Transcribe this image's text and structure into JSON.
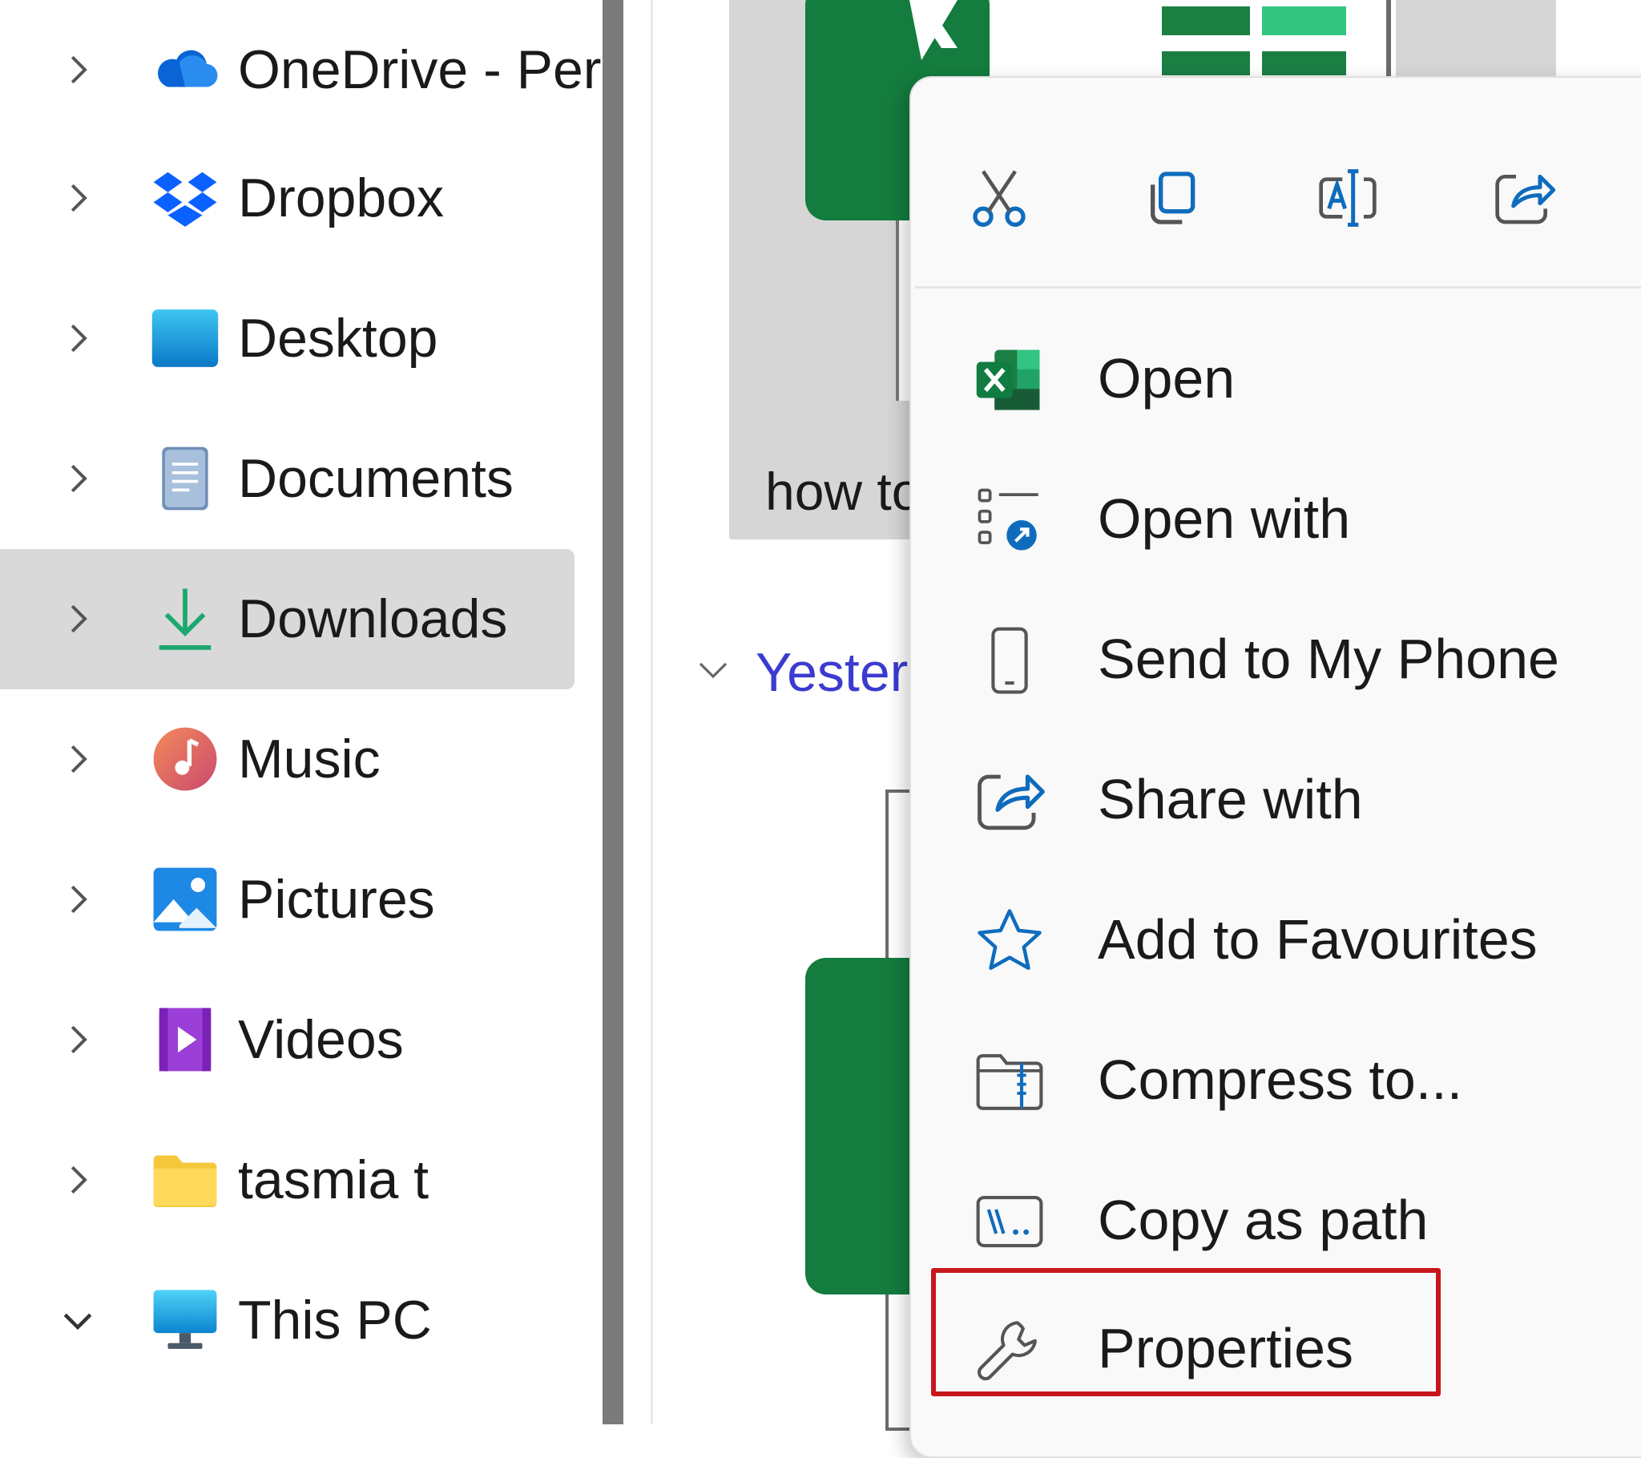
{
  "sidebar": {
    "items": [
      {
        "label": "OneDrive - Per",
        "icon": "onedrive-cloud-icon",
        "expanded": false,
        "selected": false
      },
      {
        "label": "Dropbox",
        "icon": "dropbox-icon",
        "expanded": false,
        "selected": false
      },
      {
        "label": "Desktop",
        "icon": "desktop-folder-icon",
        "expanded": false,
        "selected": false
      },
      {
        "label": "Documents",
        "icon": "documents-icon",
        "expanded": false,
        "selected": false
      },
      {
        "label": "Downloads",
        "icon": "downloads-arrow-icon",
        "expanded": false,
        "selected": true
      },
      {
        "label": "Music",
        "icon": "music-note-icon",
        "expanded": false,
        "selected": false
      },
      {
        "label": "Pictures",
        "icon": "pictures-icon",
        "expanded": false,
        "selected": false
      },
      {
        "label": "Videos",
        "icon": "videos-icon",
        "expanded": false,
        "selected": false
      },
      {
        "label": "tasmia t",
        "icon": "folder-icon",
        "expanded": false,
        "selected": false
      },
      {
        "label": "This PC",
        "icon": "monitor-icon",
        "expanded": true,
        "selected": false
      }
    ]
  },
  "content": {
    "file_tile_label": "how to",
    "group_header": "Yesterd"
  },
  "context_menu": {
    "quick_actions": [
      {
        "name": "cut",
        "icon": "scissors-icon"
      },
      {
        "name": "copy",
        "icon": "copy-icon"
      },
      {
        "name": "rename",
        "icon": "rename-icon"
      },
      {
        "name": "share",
        "icon": "share-icon"
      }
    ],
    "items": [
      {
        "label": "Open",
        "icon": "excel-icon"
      },
      {
        "label": "Open with",
        "icon": "open-with-icon"
      },
      {
        "label": "Send to My Phone",
        "icon": "phone-icon"
      },
      {
        "label": "Share with",
        "icon": "share-icon"
      },
      {
        "label": "Add to Favourites",
        "icon": "star-icon"
      },
      {
        "label": "Compress to...",
        "icon": "zip-folder-icon"
      },
      {
        "label": "Copy as path",
        "icon": "path-icon"
      },
      {
        "label": "Properties",
        "icon": "wrench-icon",
        "highlighted": true
      }
    ]
  },
  "colors": {
    "accent_blue": "#0f6cbd",
    "excel_green": "#137c3e",
    "highlight_red": "#c7161d",
    "selection_grey": "#d9d9d9"
  }
}
